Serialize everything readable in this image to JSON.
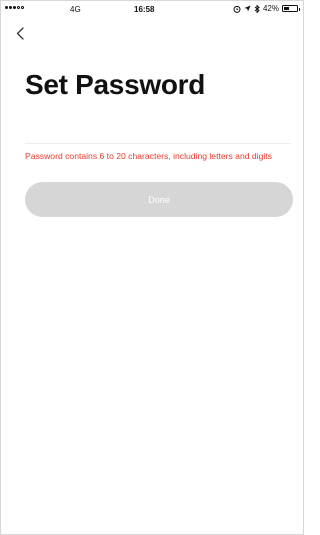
{
  "status_bar": {
    "network": "4G",
    "time": "16:58",
    "battery": "42%",
    "battery_level": 0.42,
    "icons": [
      "signal-dots-icon",
      "alarm-icon",
      "location-arrow-icon",
      "bluetooth-icon",
      "battery-icon"
    ]
  },
  "nav": {
    "back_icon": "chevron-left-icon"
  },
  "page": {
    "title": "Set Password",
    "password_value": "",
    "password_placeholder": "",
    "hint": "Password contains 6 to 20 characters, including letters and digits",
    "done_label": "Done"
  },
  "colors": {
    "hint": "#ea3a2c",
    "done_bg_disabled": "#d6d6d6",
    "done_text": "#ffffff"
  }
}
